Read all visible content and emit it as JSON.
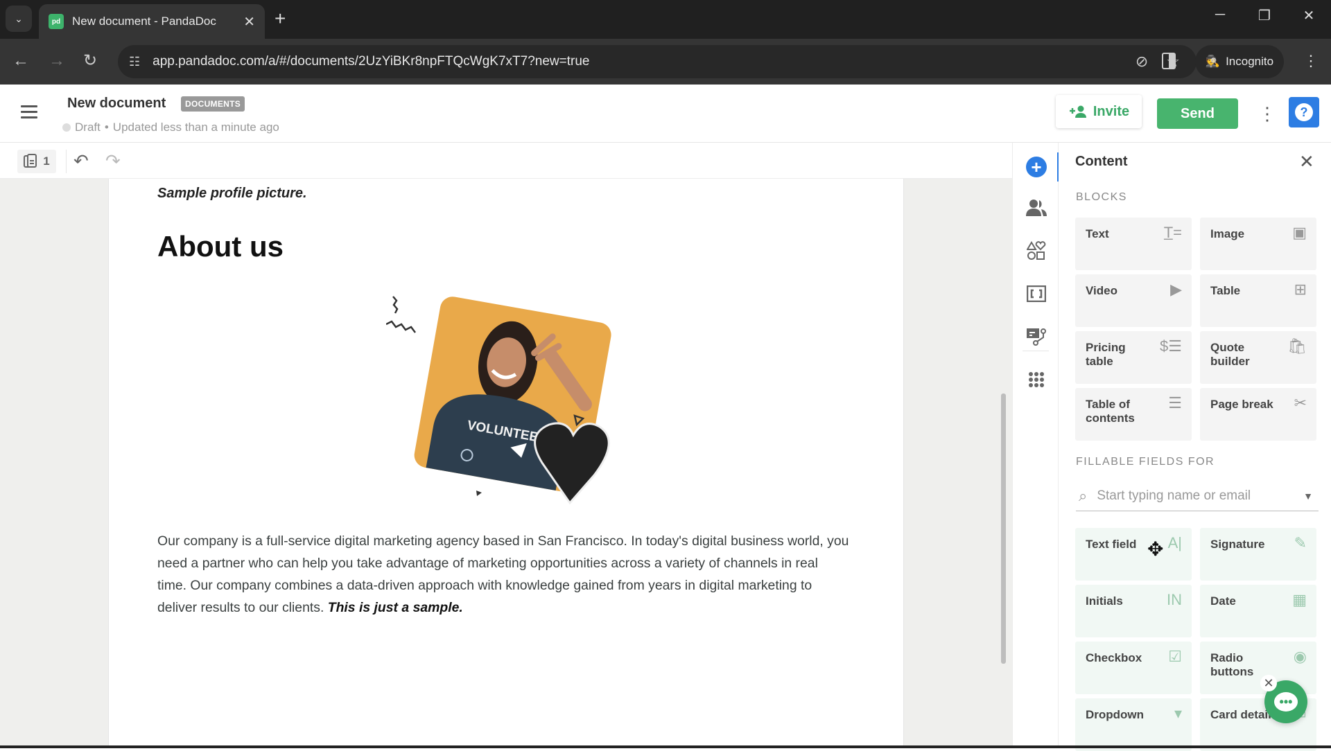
{
  "browser": {
    "tab_title": "New document - PandaDoc",
    "favicon_text": "pd",
    "url": "app.pandadoc.com/a/#/documents/2UzYiBKr8npFTQcWgK7xT7?new=true",
    "incognito_label": "Incognito"
  },
  "header": {
    "doc_title": "New document",
    "badge": "DOCUMENTS",
    "status": "Draft",
    "separator": "•",
    "updated": "Updated less than a minute ago",
    "invite_label": "Invite",
    "send_label": "Send",
    "help_glyph": "?"
  },
  "toolbar": {
    "page_count": "1"
  },
  "document": {
    "caption": "Sample profile picture.",
    "heading": "About us",
    "image_alt": "Smiling woman in VOLUNTEER t-shirt on orange background",
    "shirt_text": "VOLUNTEER",
    "paragraph": "Our company is a full-service digital marketing agency based in San Francisco. In today's digital business world, you need a partner who can help you take advantage of marketing opportunities across a variety of channels in real time. Our company combines a data-driven approach with knowledge gained from years in digital marketing to deliver results to our clients.",
    "paragraph_emphasis": "This is just a sample."
  },
  "rail": {
    "items": [
      "add-content",
      "recipients",
      "design-elements",
      "variables",
      "workflow",
      "apps"
    ]
  },
  "panel": {
    "title": "Content",
    "blocks_heading": "BLOCKS",
    "blocks": [
      {
        "label": "Text",
        "icon": "T̲="
      },
      {
        "label": "Image",
        "icon": "▣"
      },
      {
        "label": "Video",
        "icon": "▶"
      },
      {
        "label": "Table",
        "icon": "⊞"
      },
      {
        "label": "Pricing table",
        "icon": "$☰"
      },
      {
        "label": "Quote builder",
        "icon": "🛍"
      },
      {
        "label": "Table of contents",
        "icon": "☰"
      },
      {
        "label": "Page break",
        "icon": "✂"
      }
    ],
    "fields_heading": "FILLABLE FIELDS FOR",
    "search_placeholder": "Start typing name or email",
    "fields": [
      {
        "label": "Text field",
        "icon": "A|"
      },
      {
        "label": "Signature",
        "icon": "✎"
      },
      {
        "label": "Initials",
        "icon": "IN"
      },
      {
        "label": "Date",
        "icon": "▦"
      },
      {
        "label": "Checkbox",
        "icon": "☑"
      },
      {
        "label": "Radio buttons",
        "icon": "◉"
      },
      {
        "label": "Dropdown",
        "icon": "▾"
      },
      {
        "label": "Card details",
        "icon": "▭"
      }
    ]
  },
  "colors": {
    "brand_green": "#48b46e",
    "accent_blue": "#2d7de3",
    "photo_bg": "#e9a94a"
  }
}
